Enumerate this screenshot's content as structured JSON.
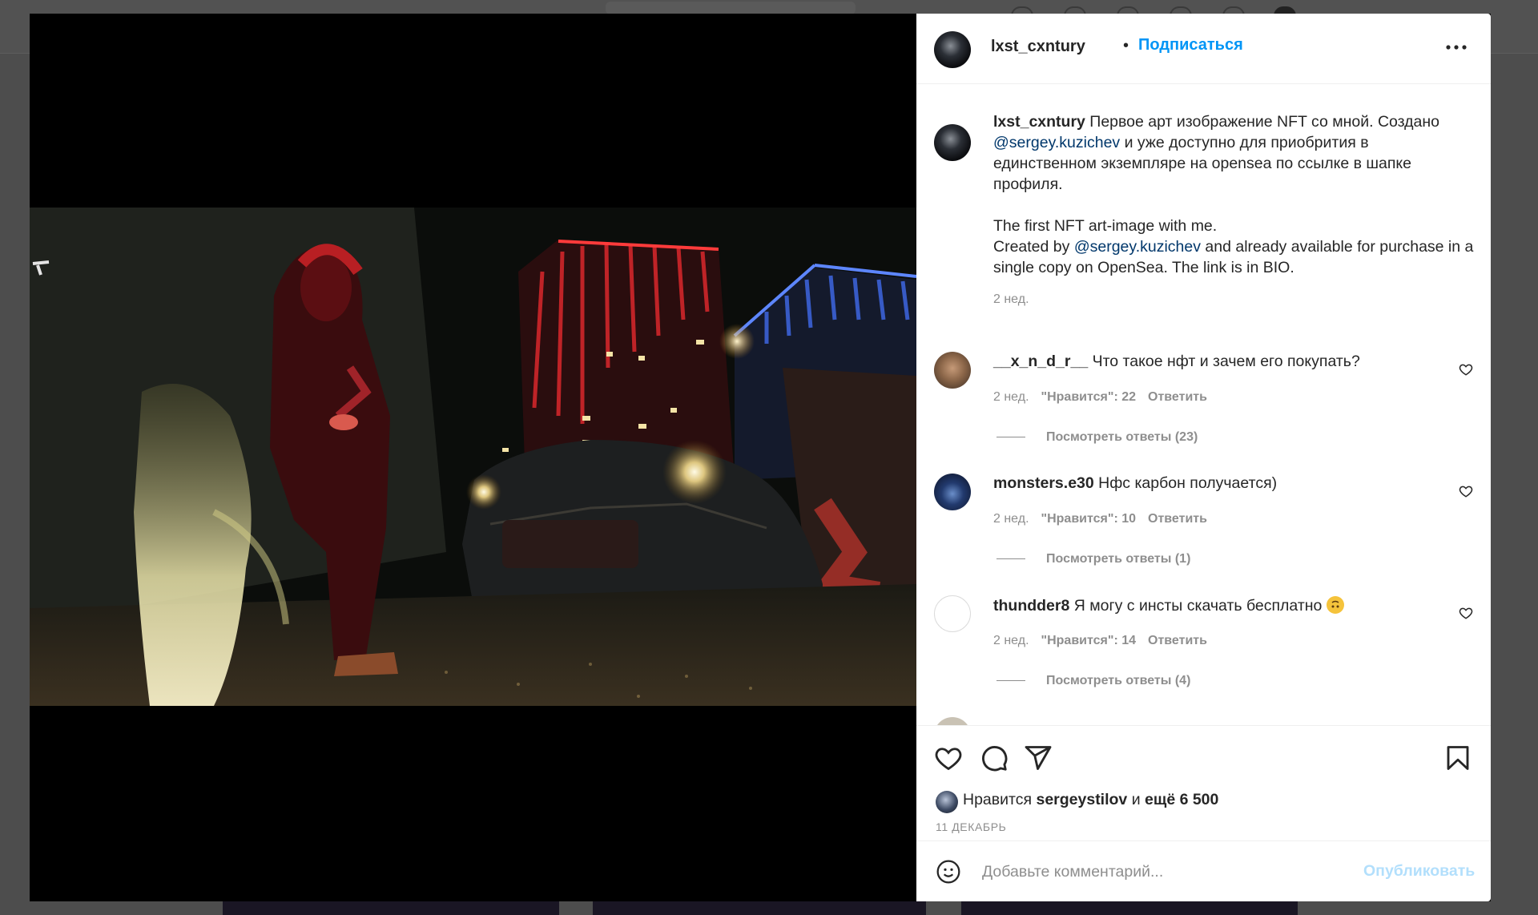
{
  "post": {
    "author": "lxst_cxntury",
    "separator": "•",
    "follow_label": "Подписаться",
    "more_label": "•••",
    "caption": {
      "part1": " Первое арт изображение NFT со мной. Создано ",
      "mention1": "@sergey.kuzichev",
      "part2": " и уже доступно для приобрития в единственном экземпляре на opensea по ссылке в шапке профиля.",
      "part3": "The first NFT art-image with me.",
      "part4": "Created by ",
      "mention2": "@sergey.kuzichev",
      "part5": " and already available for purchase in a single copy on OpenSea. The link is in BIO.",
      "time": "2 нед."
    }
  },
  "comments": [
    {
      "user": "__x_n_d_r__",
      "text": " Что такое нфт и зачем его покупать?",
      "time": "2 нед.",
      "likes": "\"Нравится\": 22",
      "reply": "Ответить",
      "view_replies": "Посмотреть ответы (23)"
    },
    {
      "user": "monsters.e30",
      "text": " Нфс карбон получается)",
      "time": "2 нед.",
      "likes": "\"Нравится\": 10",
      "reply": "Ответить",
      "view_replies": "Посмотреть ответы (1)"
    },
    {
      "user": "thundder8",
      "text": " Я могу с инсты скачать бесплатно ",
      "time": "2 нед.",
      "likes": "\"Нравится\": 14",
      "reply": "Ответить",
      "view_replies": "Посмотреть ответы (4)"
    }
  ],
  "actions": {
    "likes_prefix": "Нравится ",
    "likes_user": "sergeystilov",
    "likes_and": " и ",
    "likes_count": "ещё 6 500",
    "date": "11 ДЕКАБРЬ"
  },
  "add_comment": {
    "placeholder": "Добавьте комментарий...",
    "post_label": "Опубликовать"
  },
  "icons": {
    "like": "heart-icon",
    "comment": "comment-bubble-icon",
    "share": "paper-plane-icon",
    "save": "bookmark-icon",
    "emoji": "smiley-icon"
  },
  "colors": {
    "link": "#0095f6",
    "mention": "#00376b",
    "muted": "#8e8e8e",
    "text": "#262626"
  }
}
